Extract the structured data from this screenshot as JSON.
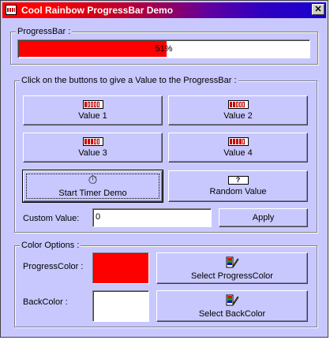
{
  "window": {
    "title": "Cool Rainbow ProgressBar Demo",
    "close_glyph": "✕"
  },
  "progress_group": {
    "legend": "ProgressBar :",
    "value": 51,
    "label": "51%",
    "fill_color": "#ff0000"
  },
  "values_group": {
    "legend": "Click on the buttons to give a Value to the ProgressBar :",
    "buttons": [
      {
        "label": "Value 1",
        "icon": "progress-bar-icon"
      },
      {
        "label": "Value 2",
        "icon": "progress-bar-icon"
      },
      {
        "label": "Value 3",
        "icon": "progress-bar-icon"
      },
      {
        "label": "Value 4",
        "icon": "progress-bar-icon"
      },
      {
        "label": "Start Timer Demo",
        "icon": "stopwatch-icon",
        "glyph": "⏱"
      },
      {
        "label": "Random Value",
        "icon": "question-bar-icon",
        "glyph": "?"
      }
    ],
    "custom_value_label": "Custom Value:",
    "custom_value": "0",
    "apply_label": "Apply"
  },
  "color_group": {
    "legend": "Color Options :",
    "progress_color_label": "ProgressColor :",
    "progress_color": "#ff0000",
    "select_progress_label": "Select ProgressColor",
    "back_color_label": "BackColor :",
    "back_color": "#ffffff",
    "select_back_label": "Select BackColor",
    "picker_icon": "color-picker-icon"
  }
}
